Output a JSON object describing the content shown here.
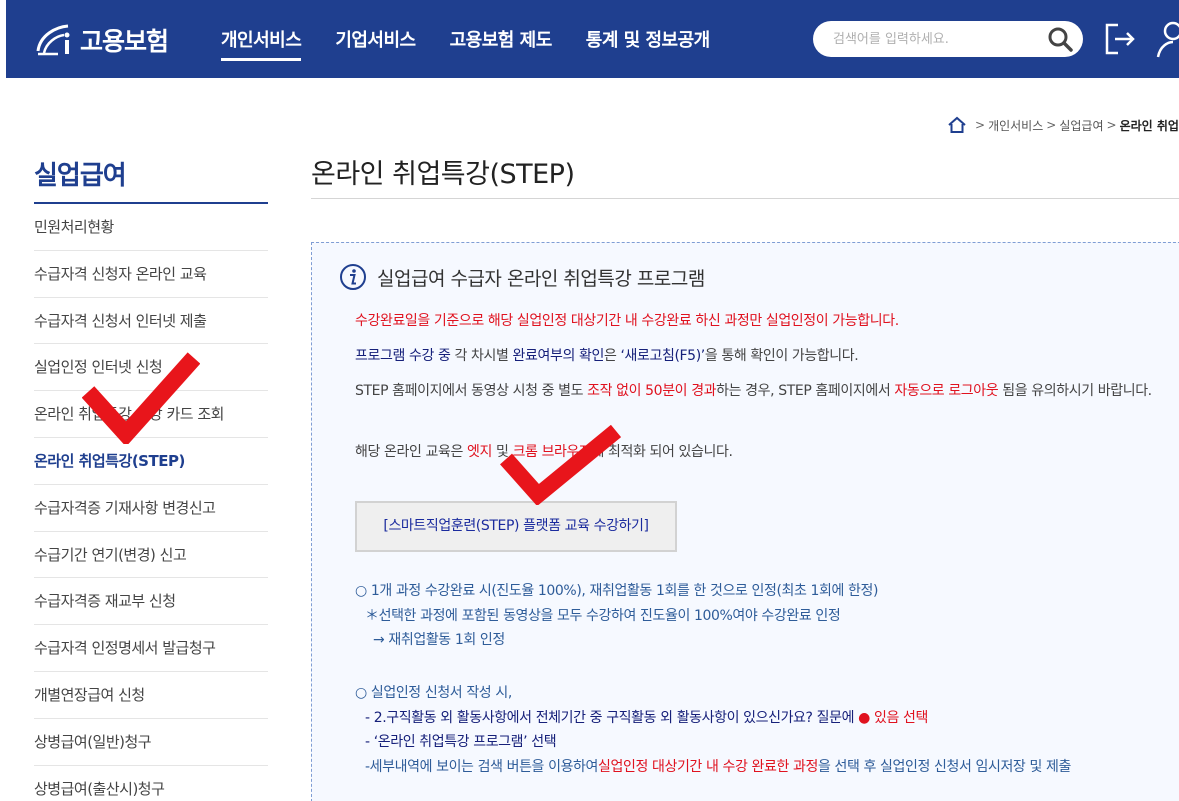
{
  "header": {
    "logo_text": "고용보험",
    "nav": [
      {
        "label": "개인서비스",
        "active": true
      },
      {
        "label": "기업서비스",
        "active": false
      },
      {
        "label": "고용보험 제도",
        "active": false
      },
      {
        "label": "통계 및 정보공개",
        "active": false
      }
    ],
    "search_placeholder": "검색어를 입력하세요."
  },
  "breadcrumb": {
    "items": [
      "개인서비스",
      "실업급여"
    ],
    "current": "온라인 취업"
  },
  "sidebar": {
    "title": "실업급여",
    "items": [
      {
        "label": "민원처리현황",
        "active": false
      },
      {
        "label": "수급자격 신청자 온라인 교육",
        "active": false
      },
      {
        "label": "수급자격 신청서 인터넷 제출",
        "active": false
      },
      {
        "label": "실업인정 인터넷 신청",
        "active": false
      },
      {
        "label": "온라인 취업특강 수강 카드 조회",
        "active": false
      },
      {
        "label": "온라인 취업특강(STEP)",
        "active": true
      },
      {
        "label": "수급자격증 기재사항 변경신고",
        "active": false
      },
      {
        "label": "수급기간 연기(변경) 신고",
        "active": false
      },
      {
        "label": "수급자격증 재교부 신청",
        "active": false
      },
      {
        "label": "수급자격 인정명세서 발급청구",
        "active": false
      },
      {
        "label": "개별연장급여 신청",
        "active": false
      },
      {
        "label": "상병급여(일반)청구",
        "active": false
      },
      {
        "label": "상병급여(출산시)청구",
        "active": false
      }
    ]
  },
  "page_title": "온라인 취업특강(STEP)",
  "info": {
    "title": "실업급여 수급자 온라인 취업특강 프로그램",
    "p1": {
      "a": "수강완료일을 기준으로 해당 실업인정 대상기간 내 수강완료 하신 과정만 실업인정이 가능합니다."
    },
    "p2": {
      "a": "프로그램 수강 중",
      "b": " 각 차시별 ",
      "c": "완료여부의 확인",
      "d": "은 ",
      "e": "‘새로고침(F5)’",
      "f": "을 통해 확인이 가능합니다."
    },
    "p3": {
      "a": "STEP 홈페이지에서 동영상 시청 중 별도 ",
      "b": "조작 없이 50분이 경과",
      "c": "하는 경우, STEP 홈페이지에서 ",
      "d": "자동으로 로그아웃",
      "e": " 됨을 유의하시기 바랍니다."
    },
    "p4": {
      "a": "해당 온라인 교육은 ",
      "b": "엣지",
      "c": " 및 ",
      "d": "크롬 브라우저",
      "e": "에 최적화 되어 있습니다."
    },
    "course_button": "[스마트직업훈련(STEP) 플랫폼 교육 수강하기]",
    "list1": [
      "○ 1개 과정 수강완료 시(진도율 100%), 재취업활동 1회를 한 것으로 인정(최초 1회에 한정)",
      "＊선택한 과정에 포함된 동영상을 모두 수강하여 진도율이 100%여야 수강완료 인정",
      "→ 재취업활동 1회 인정"
    ],
    "list2": {
      "line1": "○ 실업인정 신청서 작성 시,",
      "line2_a": "- 2.구직활동 외 활동사항에서 전체기간 중 구직활동 외 활동사항이 있으신가요? 질문에 ",
      "line2_dot": "●",
      "line2_b": " 있음 선택",
      "line3": "- ‘온라인 취업특강 프로그램’ 선택",
      "line4_a": "-세부내역에 보이는 검색 버튼을 이용하여",
      "line4_b": "실업인정 대상기간 내 수강 완료한 과정",
      "line4_c": "을 선택 후 실업인정 신청서 임시저장 및 제출"
    }
  },
  "colors": {
    "header_bg": "#1f3f8f",
    "accent_red": "#e0121f",
    "check_red": "#e8151b",
    "info_border": "#7f9dd4"
  }
}
